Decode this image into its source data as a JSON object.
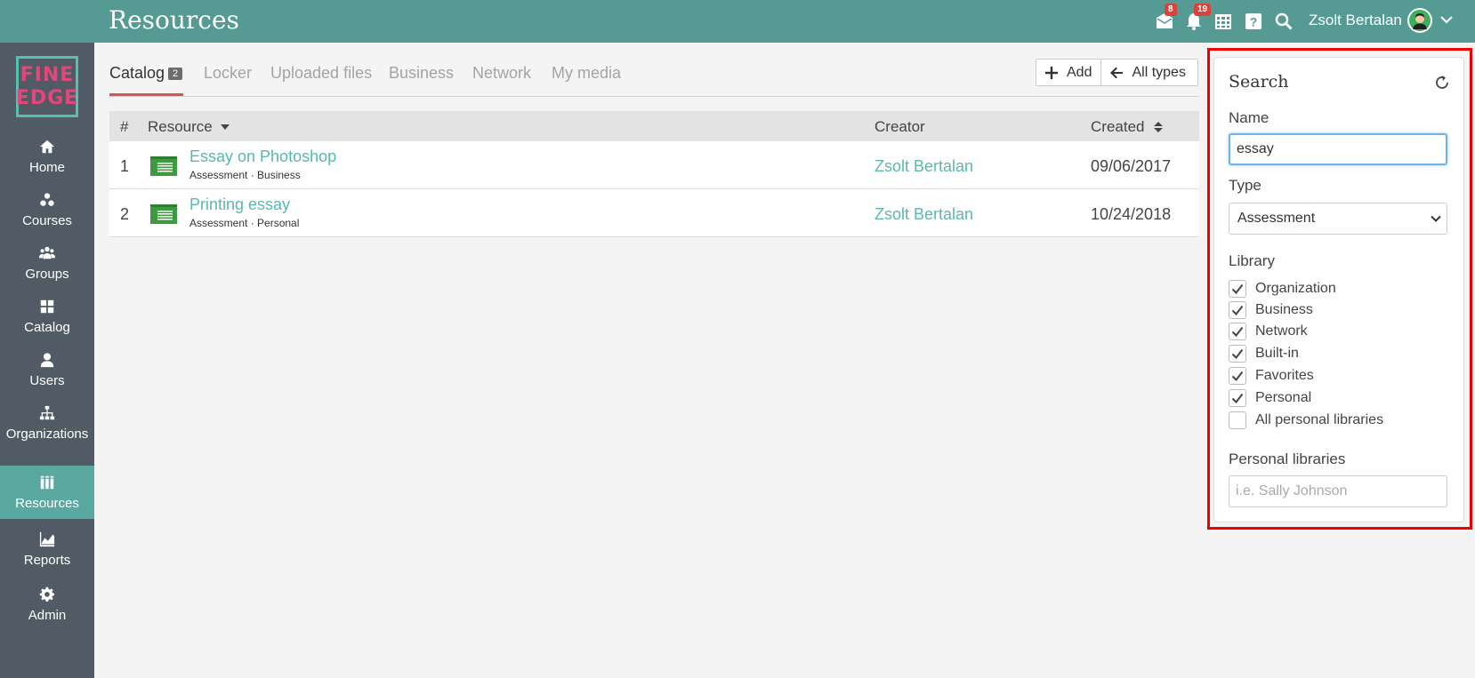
{
  "header": {
    "title": "Resources",
    "mail_badge": "8",
    "notif_badge": "19",
    "user_name": "Zsolt Bertalan"
  },
  "logo": {
    "line1": "FINE",
    "line2": "EDGE"
  },
  "sidebar": {
    "items": [
      {
        "label": "Home",
        "icon": "home-icon"
      },
      {
        "label": "Courses",
        "icon": "courses-icon"
      },
      {
        "label": "Groups",
        "icon": "groups-icon"
      },
      {
        "label": "Catalog",
        "icon": "catalog-icon"
      },
      {
        "label": "Users",
        "icon": "user-icon"
      },
      {
        "label": "Organizations",
        "icon": "org-chart-icon"
      },
      {
        "label": "Resources",
        "icon": "books-icon",
        "active": true
      },
      {
        "label": "Reports",
        "icon": "chart-icon"
      },
      {
        "label": "Admin",
        "icon": "gear-icon"
      }
    ]
  },
  "tabs": {
    "catalog": "Catalog",
    "catalog_count": "2",
    "locker": "Locker",
    "uploaded": "Uploaded files",
    "business": "Business",
    "network": "Network",
    "media": "My media"
  },
  "toolbar": {
    "add_label": "Add",
    "all_types_label": "All types"
  },
  "table": {
    "columns": {
      "num": "#",
      "resource": "Resource",
      "creator": "Creator",
      "created": "Created"
    },
    "rows": [
      {
        "num": "1",
        "name": "Essay on Photoshop",
        "sub": "Assessment · Business",
        "creator": "Zsolt Bertalan",
        "created": "09/06/2017"
      },
      {
        "num": "2",
        "name": "Printing essay",
        "sub": "Assessment · Personal",
        "creator": "Zsolt Bertalan",
        "created": "10/24/2018"
      }
    ]
  },
  "search": {
    "title": "Search",
    "name_label": "Name",
    "name_value": "essay",
    "type_label": "Type",
    "type_value": "Assessment",
    "library_label": "Library",
    "libraries": [
      {
        "label": "Organization",
        "checked": true
      },
      {
        "label": "Business",
        "checked": true
      },
      {
        "label": "Network",
        "checked": true
      },
      {
        "label": "Built-in",
        "checked": true
      },
      {
        "label": "Favorites",
        "checked": true
      },
      {
        "label": "Personal",
        "checked": true
      },
      {
        "label": "All personal libraries",
        "checked": false
      }
    ],
    "personal_label": "Personal libraries",
    "personal_placeholder": "i.e. Sally Johnson"
  },
  "colors": {
    "header": "#559a93",
    "sidebar": "#505b66",
    "accent": "#5ab8ad",
    "active_tab": "#d9534f",
    "badge": "#d9433b"
  }
}
